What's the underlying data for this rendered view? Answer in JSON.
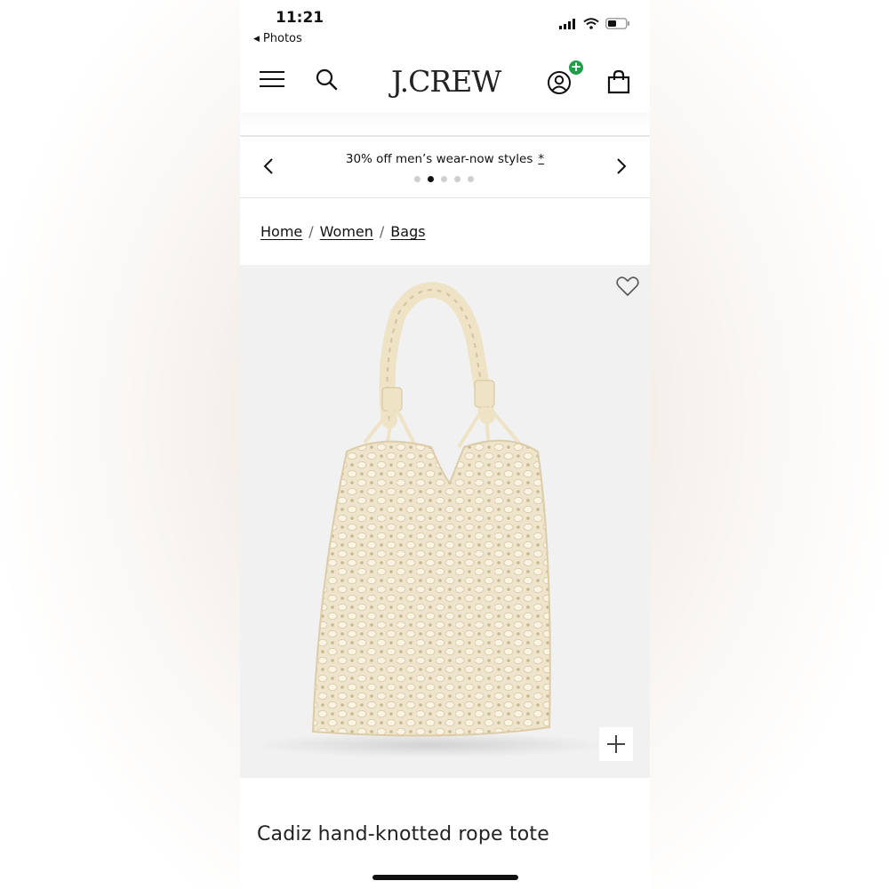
{
  "status_bar": {
    "time": "11:21",
    "back_label": "Photos"
  },
  "header": {
    "logo": "J.CREW"
  },
  "promo": {
    "text": "30% off men’s wear-now styles",
    "disclaimer": "*",
    "dots": 5,
    "active_dot": 2
  },
  "breadcrumb": {
    "items": [
      "Home",
      "Women",
      "Bags"
    ],
    "separator": "/"
  },
  "product": {
    "title": "Cadiz hand-knotted rope tote"
  },
  "icons": {
    "menu": "hamburger-icon",
    "search": "search-icon",
    "account": "user-icon",
    "account_badge": "plus-badge-icon",
    "bag": "shopping-bag-icon",
    "wishlist": "heart-icon",
    "zoom": "plus-icon",
    "prev": "chevron-left-icon",
    "next": "chevron-right-icon"
  },
  "colors": {
    "badge": "#1f9d4b",
    "bag": "#f3ead6",
    "image_bg": "#f1f1f1"
  }
}
